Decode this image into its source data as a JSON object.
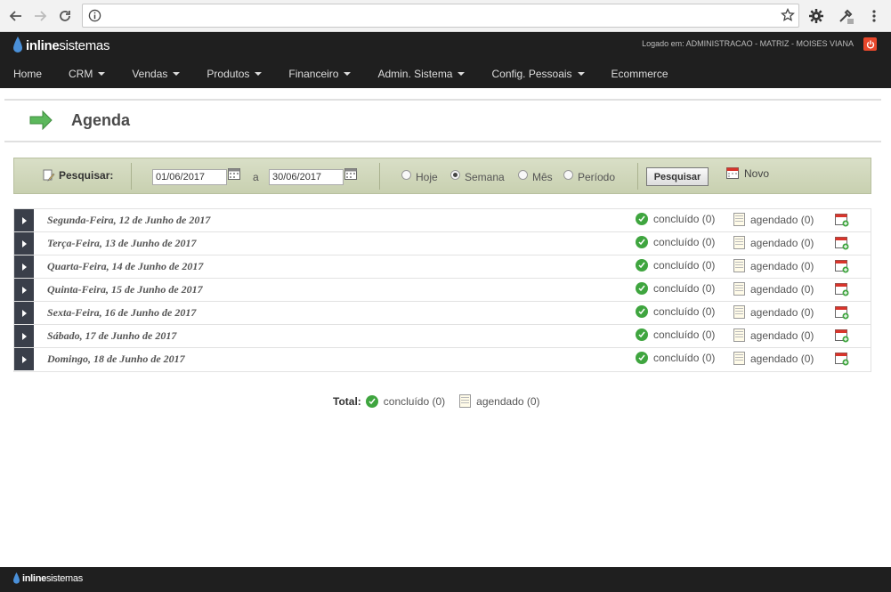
{
  "browser": {
    "back_icon": "arrow-left-icon",
    "forward_icon": "arrow-right-icon",
    "reload_icon": "reload-icon",
    "info_icon": "info-icon",
    "url": "",
    "bookmark_icon": "star-icon"
  },
  "header": {
    "logo_bold": "inline",
    "logo_rest": "sistemas",
    "logged_in": "Logado em: ADMINISTRACAO - MATRIZ - MOISES VIANA",
    "menu": [
      {
        "label": "Home",
        "dropdown": false
      },
      {
        "label": "CRM",
        "dropdown": true
      },
      {
        "label": "Vendas",
        "dropdown": true
      },
      {
        "label": "Produtos",
        "dropdown": true
      },
      {
        "label": "Financeiro",
        "dropdown": true
      },
      {
        "label": "Admin. Sistema",
        "dropdown": true
      },
      {
        "label": "Config. Pessoais",
        "dropdown": true
      },
      {
        "label": "Ecommerce",
        "dropdown": false
      }
    ]
  },
  "page": {
    "title": "Agenda"
  },
  "search": {
    "label": "Pesquisar:",
    "date_from": "01/06/2017",
    "between": "a",
    "date_to": "30/06/2017",
    "options": [
      "Hoje",
      "Semana",
      "Mês",
      "Período"
    ],
    "selected": "Semana",
    "button": "Pesquisar",
    "new_label": "Novo"
  },
  "days": [
    {
      "label": "Segunda-Feira, 12 de Junho de 2017",
      "done": "concluído (0)",
      "scheduled": "agendado (0)"
    },
    {
      "label": "Terça-Feira, 13 de Junho de 2017",
      "done": "concluído (0)",
      "scheduled": "agendado (0)"
    },
    {
      "label": "Quarta-Feira, 14 de Junho de 2017",
      "done": "concluído (0)",
      "scheduled": "agendado (0)"
    },
    {
      "label": "Quinta-Feira, 15 de Junho de 2017",
      "done": "concluído (0)",
      "scheduled": "agendado (0)"
    },
    {
      "label": "Sexta-Feira, 16 de Junho de 2017",
      "done": "concluído (0)",
      "scheduled": "agendado (0)"
    },
    {
      "label": "Sábado, 17 de Junho de 2017",
      "done": "concluído (0)",
      "scheduled": "agendado (0)"
    },
    {
      "label": "Domingo, 18 de Junho de 2017",
      "done": "concluído (0)",
      "scheduled": "agendado (0)"
    }
  ],
  "total": {
    "label": "Total:",
    "done": "concluído (0)",
    "scheduled": "agendado (0)"
  },
  "colors": {
    "header_bg": "#1f1f1f",
    "accent_blue": "#4a90d9",
    "search_bar_bg": "#d9dfc7",
    "check_green": "#3fa53f",
    "power_red": "#e8472b"
  }
}
